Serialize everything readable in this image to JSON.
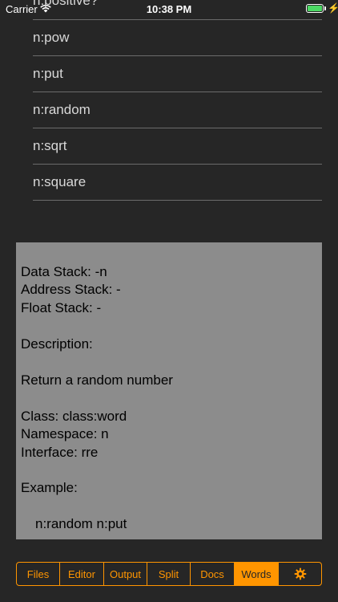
{
  "status_bar": {
    "carrier": "Carrier",
    "time": "10:38 PM",
    "battery_level": 1.0,
    "charging_glyph": "⚡"
  },
  "word_list": {
    "items": [
      "n:positive?",
      "n:pow",
      "n:put",
      "n:random",
      "n:sqrt",
      "n:square"
    ]
  },
  "details": {
    "data_stack": "Data Stack: -n",
    "address_stack": "Address Stack: -",
    "float_stack": "Float Stack: -",
    "description_heading": "Description:",
    "description": "Return a random number",
    "class": "Class: class:word",
    "namespace": "Namespace: n",
    "interface": "Interface: rre",
    "example_heading": "Example:",
    "example": "n:random n:put"
  },
  "tabs": {
    "items": [
      "Files",
      "Editor",
      "Output",
      "Split",
      "Docs",
      "Words"
    ],
    "active": "Words",
    "settings_icon": "gear-icon"
  },
  "colors": {
    "background": "#262626",
    "accent": "#ff9500",
    "panel": "#8c8c8c",
    "list_text": "#d8d8d8",
    "separator": "#6b6b6b",
    "battery": "#4cd964"
  }
}
